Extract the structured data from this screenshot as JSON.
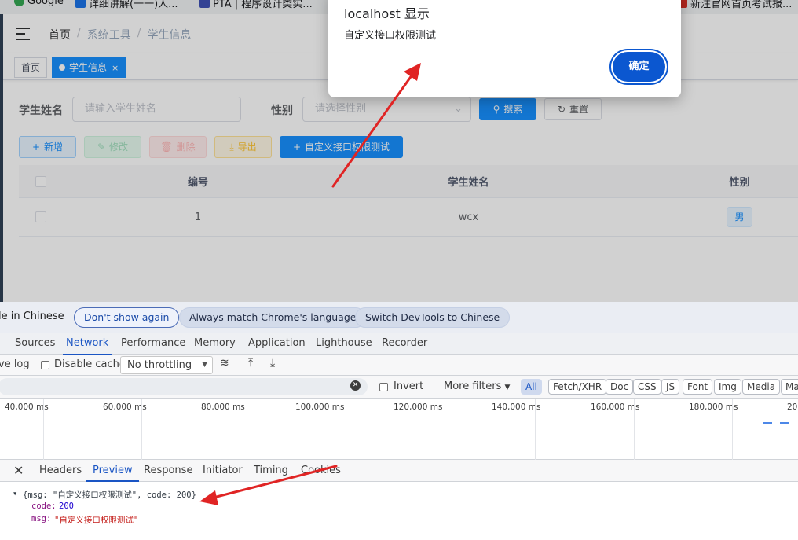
{
  "bookmarks": [
    {
      "label": "Google",
      "color": "#34a853"
    },
    {
      "label": "详细讲解(一一)人...",
      "color": "#1a73e8"
    },
    {
      "label": "PTA | 程序设计类实...",
      "color": "#3f51b5"
    },
    {
      "label": "新注官网首页考试报...",
      "color": "#d93025"
    }
  ],
  "app": {
    "breadcrumb": [
      "首页",
      "系统工具",
      "学生信息"
    ],
    "breadcrumb_sep": "/",
    "tags": [
      {
        "label": "首页"
      },
      {
        "label": "学生信息",
        "close": "×"
      }
    ],
    "search": {
      "name_label": "学生姓名",
      "name_placeholder": "请输入学生姓名",
      "gender_label": "性别",
      "gender_placeholder": "请选择性别",
      "search_btn": "搜索",
      "reset_btn": "重置"
    },
    "actions": {
      "add": "新增",
      "edit": "修改",
      "delete": "删除",
      "export": "导出",
      "custom": "自定义接口权限测试"
    },
    "table": {
      "columns": [
        "编号",
        "学生姓名",
        "性别"
      ],
      "rows": [
        {
          "id": "1",
          "name": "wcx",
          "gender": "男"
        }
      ]
    }
  },
  "dialog": {
    "title": "localhost 显示",
    "message": "自定义接口权限测试",
    "ok": "确定"
  },
  "devtools": {
    "infobar": {
      "text": "le in Chinese",
      "dont_show": "Don't show again",
      "always_match": "Always match Chrome's language",
      "switch": "Switch DevTools to Chinese"
    },
    "tabs": [
      "Sources",
      "Network",
      "Performance",
      "Memory",
      "Application",
      "Lighthouse",
      "Recorder"
    ],
    "active_tab": "Network",
    "toolbar": {
      "preserve_log": "ve log",
      "disable_cache": "Disable cache",
      "throttling": "No throttling"
    },
    "filter": {
      "invert": "Invert",
      "more_filters": "More filters",
      "chips": [
        "All",
        "Fetch/XHR",
        "Doc",
        "CSS",
        "JS",
        "Font",
        "Img",
        "Media",
        "Ma"
      ]
    },
    "timeline_ticks": [
      "40,000 ms",
      "60,000 ms",
      "80,000 ms",
      "100,000 ms",
      "120,000 ms",
      "140,000 ms",
      "160,000 ms",
      "180,000 ms",
      "20"
    ],
    "detail_tabs": [
      "Headers",
      "Preview",
      "Response",
      "Initiator",
      "Timing",
      "Cookies"
    ],
    "active_detail_tab": "Preview",
    "preview": {
      "summary": "{msg: \"自定义接口权限测试\", code: 200}",
      "code_key": "code:",
      "code_val": "200",
      "msg_key": "msg:",
      "msg_val": "\"自定义接口权限测试\""
    }
  },
  "colors": {
    "primary": "#1890ff",
    "dialog_button": "#0b57d0",
    "devtools_accent": "#1a55c4",
    "annotation_arrow": "#e02424"
  }
}
